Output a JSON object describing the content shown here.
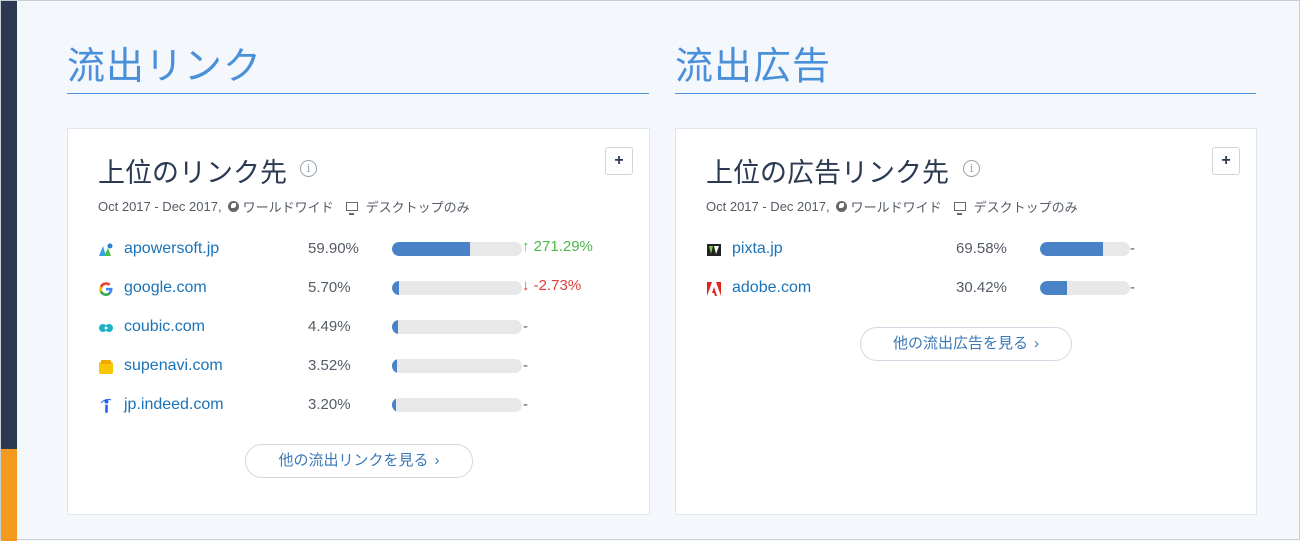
{
  "sections": {
    "outgoing_links_title": "流出リンク",
    "outgoing_ads_title": "流出広告"
  },
  "links_card": {
    "title": "上位のリンク先",
    "info_icon": "i",
    "plus_label": "+",
    "meta": {
      "period": "Oct 2017 - Dec 2017,",
      "region": "ワールドワイド",
      "device": "デスクトップのみ"
    },
    "rows": [
      {
        "domain": "apowersoft.jp",
        "pct": "59.90%",
        "share": 0.599,
        "change": "271.29%",
        "direction": "up",
        "icon": "apowersoft-favicon"
      },
      {
        "domain": "google.com",
        "pct": "5.70%",
        "share": 0.057,
        "change": "-2.73%",
        "direction": "down",
        "icon": "google-favicon"
      },
      {
        "domain": "coubic.com",
        "pct": "4.49%",
        "share": 0.0449,
        "change": "-",
        "direction": "none",
        "icon": "coubic-favicon"
      },
      {
        "domain": "supenavi.com",
        "pct": "3.52%",
        "share": 0.0352,
        "change": "-",
        "direction": "none",
        "icon": "supenavi-favicon"
      },
      {
        "domain": "jp.indeed.com",
        "pct": "3.20%",
        "share": 0.032,
        "change": "-",
        "direction": "none",
        "icon": "indeed-favicon"
      }
    ],
    "more_label": "他の流出リンクを見る"
  },
  "ads_card": {
    "title": "上位の広告リンク先",
    "info_icon": "i",
    "plus_label": "+",
    "meta": {
      "period": "Oct 2017 - Dec 2017,",
      "region": "ワールドワイド",
      "device": "デスクトップのみ"
    },
    "rows": [
      {
        "domain": "pixta.jp",
        "pct": "69.58%",
        "share": 0.6958,
        "change": "-",
        "icon": "pixta-favicon"
      },
      {
        "domain": "adobe.com",
        "pct": "30.42%",
        "share": 0.3042,
        "change": "-",
        "icon": "adobe-favicon"
      }
    ],
    "more_label": "他の流出広告を見る"
  },
  "colors": {
    "accent_blue": "#4a90d9",
    "bar_fill": "#4a82c8",
    "up_green": "#4cb84c",
    "down_red": "#e23b3b",
    "sidebar_dark": "#2b3a52",
    "sidebar_orange": "#f39a1e"
  }
}
